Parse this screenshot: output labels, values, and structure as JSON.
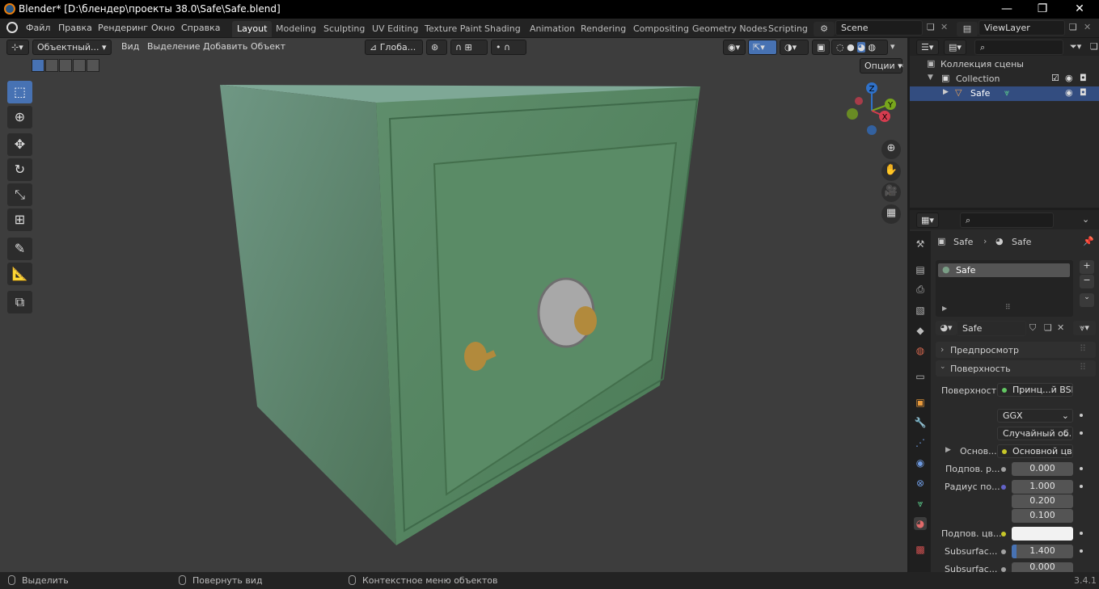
{
  "window": {
    "title": "Blender* [D:\\блендер\\проекты 38.0\\Safe\\Safe.blend]",
    "min": "—",
    "max": "❐",
    "close": "✕"
  },
  "menus": [
    "Файл",
    "Правка",
    "Рендеринг",
    "Окно",
    "Справка"
  ],
  "workspaces": [
    "Layout",
    "Modeling",
    "Sculpting",
    "UV Editing",
    "Texture Paint",
    "Shading",
    "Animation",
    "Rendering",
    "Compositing",
    "Geometry Nodes",
    "Scripting"
  ],
  "scene": {
    "name": "Scene",
    "view_layer": "ViewLayer"
  },
  "viewport": {
    "mode": "Объектный...",
    "menus": [
      "Вид",
      "Выделение",
      "Добавить",
      "Объект"
    ],
    "transform": "Глоба...",
    "options": "Опции",
    "gizmo": {
      "x": "X",
      "y": "Y",
      "z": "Z"
    }
  },
  "outliner": {
    "root": "Коллекция сцены",
    "collection": "Collection",
    "object": "Safe"
  },
  "properties": {
    "breadcrumb_object": "Safe",
    "breadcrumb_material": "Safe",
    "slot": "Safe",
    "material_name": "Safe",
    "preview": "Предпросмотр",
    "surface_panel": "Поверхность",
    "surface_label": "Поверхность",
    "surface_value": "Принц...й BSDF",
    "distribution": "GGX",
    "subsurface_method": "Случайный об...",
    "base_label": "Основ...",
    "base_value": "Основной цвет",
    "ss_weight_label": "Подпов. р...",
    "ss_weight": "0.000",
    "ss_radius_label": "Радиус по...",
    "ss_radius": [
      "1.000",
      "0.200",
      "0.100"
    ],
    "ss_color_label": "Подпов. цв...",
    "ss_ior_label": "Subsurfac...",
    "ss_ior": "1.400",
    "ss_aniso_label": "Subsurfac...",
    "ss_aniso": "0.000"
  },
  "status": {
    "select": "Выделить",
    "rotate": "Повернуть вид",
    "context": "Контекстное меню объектов",
    "version": "3.4.1"
  }
}
